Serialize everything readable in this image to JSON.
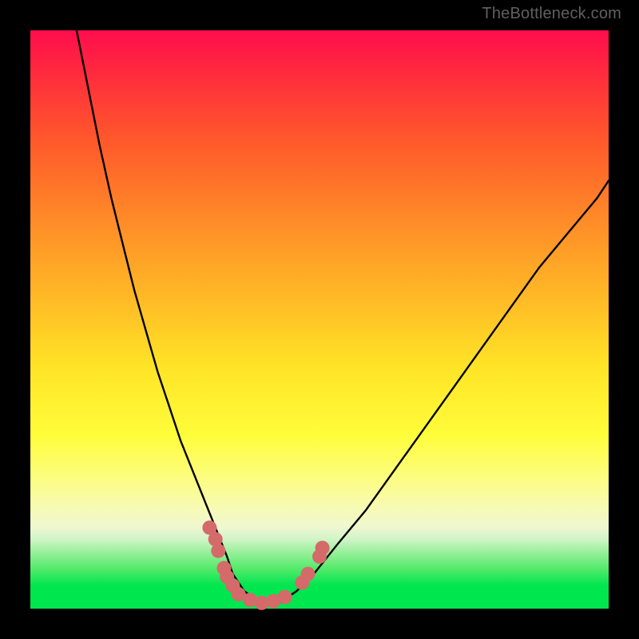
{
  "attribution": "TheBottleneck.com",
  "chart_data": {
    "type": "line",
    "title": "",
    "xlabel": "",
    "ylabel": "",
    "xlim": [
      0,
      100
    ],
    "ylim": [
      0,
      100
    ],
    "series": [
      {
        "name": "bottleneck-curve",
        "x": [
          8,
          10,
          12,
          14,
          16,
          18,
          20,
          22,
          24,
          26,
          28,
          30,
          32,
          34,
          35,
          37,
          40,
          43,
          46,
          49,
          53,
          58,
          63,
          68,
          73,
          78,
          83,
          88,
          93,
          98,
          100
        ],
        "y": [
          100,
          90,
          80,
          71,
          63,
          55,
          48,
          41,
          35,
          29,
          24,
          19,
          14,
          9,
          6,
          3,
          1,
          1,
          3,
          6,
          11,
          17,
          24,
          31,
          38,
          45,
          52,
          59,
          65,
          71,
          74
        ]
      }
    ],
    "markers": {
      "name": "highlight-markers",
      "color": "#d46a6a",
      "points": [
        {
          "x": 31,
          "y": 14
        },
        {
          "x": 32,
          "y": 12
        },
        {
          "x": 32.5,
          "y": 10
        },
        {
          "x": 33.5,
          "y": 7
        },
        {
          "x": 34,
          "y": 5.5
        },
        {
          "x": 35,
          "y": 4
        },
        {
          "x": 36,
          "y": 2.5
        },
        {
          "x": 38,
          "y": 1.5
        },
        {
          "x": 40,
          "y": 1
        },
        {
          "x": 42,
          "y": 1.3
        },
        {
          "x": 44,
          "y": 2
        },
        {
          "x": 47,
          "y": 4.5
        },
        {
          "x": 48,
          "y": 6
        },
        {
          "x": 50,
          "y": 9
        },
        {
          "x": 50.5,
          "y": 10.5
        }
      ]
    }
  }
}
